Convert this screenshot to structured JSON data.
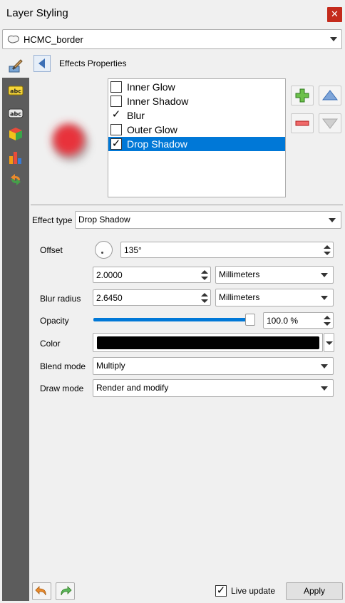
{
  "window": {
    "title": "Layer Styling",
    "close_glyph": "✕"
  },
  "layer_select": {
    "value": "HCMC_border",
    "icon": "polygon-layer-icon"
  },
  "sidebar": {
    "items": [
      {
        "icon": "symbology-brush-icon"
      },
      {
        "icon": "labels-abc-yellow-icon"
      },
      {
        "icon": "labels-abc-icon"
      },
      {
        "icon": "3d-cube-icon"
      },
      {
        "icon": "diagram-icon"
      },
      {
        "icon": "history-icon"
      }
    ]
  },
  "effects": {
    "header": "Effects Properties",
    "items": [
      {
        "label": "Inner Glow",
        "checked": false,
        "selected": false
      },
      {
        "label": "Inner Shadow",
        "checked": false,
        "selected": false
      },
      {
        "label": "Blur",
        "checked": true,
        "selected": false
      },
      {
        "label": "Outer Glow",
        "checked": false,
        "selected": false
      },
      {
        "label": "Drop Shadow",
        "checked": true,
        "selected": true
      }
    ],
    "check_glyph": "✓",
    "preview_color": "#e8303a"
  },
  "form": {
    "effect_type": {
      "label": "Effect type",
      "value": "Drop Shadow"
    },
    "offset": {
      "label": "Offset",
      "angle": "135°",
      "distance": "2.0000",
      "unit": "Millimeters"
    },
    "blur_radius": {
      "label": "Blur radius",
      "value": "2.6450",
      "unit": "Millimeters"
    },
    "opacity": {
      "label": "Opacity",
      "value": "100.0 %",
      "level": 1.0
    },
    "color": {
      "label": "Color",
      "value": "#000000"
    },
    "blend_mode": {
      "label": "Blend mode",
      "value": "Multiply"
    },
    "draw_mode": {
      "label": "Draw mode",
      "value": "Render and modify"
    }
  },
  "footer": {
    "live_update_label": "Live update",
    "live_update_checked": true,
    "apply_label": "Apply"
  },
  "colors": {
    "accent": "#0078d7",
    "close": "#c42b1c",
    "sidebar": "#5c5c5c"
  }
}
